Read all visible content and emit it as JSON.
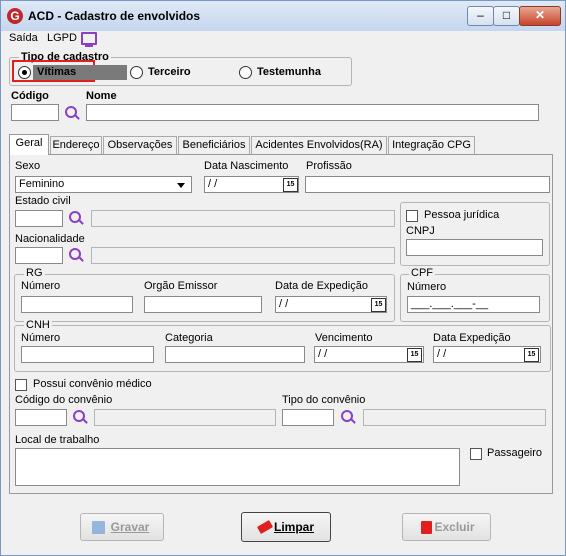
{
  "window": {
    "title": "ACD - Cadastro de envolvidos",
    "app_icon": "G"
  },
  "menu": {
    "saida": "Saída",
    "lgpd": "LGPD"
  },
  "tipo_cadastro": {
    "title": "Tipo de cadastro",
    "options": [
      "Vítimas",
      "Terceiro",
      "Testemunha"
    ],
    "selected": "Vítimas"
  },
  "header_fields": {
    "codigo_label": "Código",
    "nome_label": "Nome",
    "codigo_value": "",
    "nome_value": ""
  },
  "tabs": [
    "Geral",
    "Endereço",
    "Observações",
    "Beneficiários",
    "Acidentes Envolvidos(RA)",
    "Integração CPG"
  ],
  "active_tab": "Geral",
  "geral": {
    "sexo_label": "Sexo",
    "sexo_value": "Feminino",
    "data_nasc_label": "Data Nascimento",
    "data_nasc_value": " / /",
    "profissao_label": "Profissão",
    "estado_civil_label": "Estado civil",
    "nacionalidade_label": "Nacionalidade",
    "pessoa_juridica_label": "Pessoa jurídica",
    "cnpj_label": "CNPJ",
    "rg": {
      "title": "RG",
      "numero_label": "Número",
      "orgao_label": "Orgão Emissor",
      "data_exp_label": "Data de Expedição",
      "data_exp_value": " / /"
    },
    "cpf": {
      "title": "CPF",
      "numero_label": "Número",
      "numero_value": "___.___.___-__"
    },
    "cnh": {
      "title": "CNH",
      "numero_label": "Número",
      "categoria_label": "Categoria",
      "vencimento_label": "Vencimento",
      "vencimento_value": " / /",
      "data_exp_label": "Data Expedição",
      "data_exp_value": " / /"
    },
    "convenio_label": "Possui convênio médico",
    "cod_convenio_label": "Código do convênio",
    "tipo_convenio_label": "Tipo do convênio",
    "local_trabalho_label": "Local de trabalho",
    "passageiro_label": "Passageiro",
    "cal_icon_text": "15"
  },
  "buttons": {
    "gravar": "Gravar",
    "limpar": "Limpar",
    "excluir": "Excluir"
  },
  "colors": {
    "accent": "#8b3fc9",
    "highlight": "#e0201e"
  }
}
